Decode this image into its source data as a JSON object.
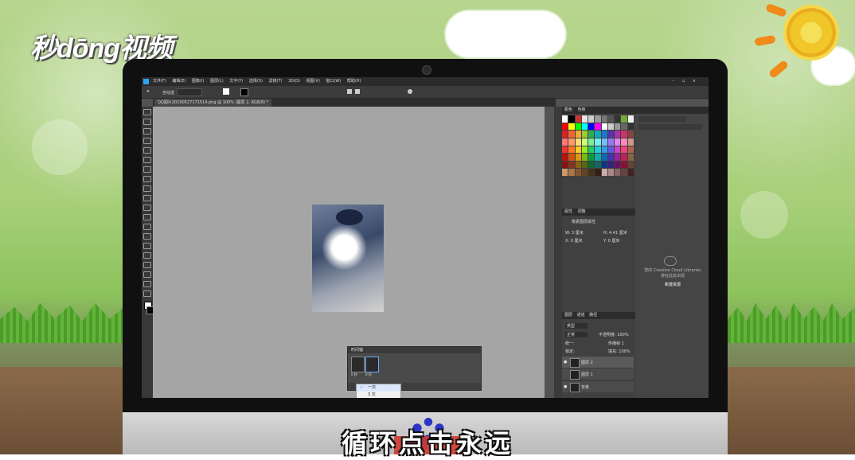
{
  "watermark": {
    "logo_text": "秒dōng视频"
  },
  "photoshop": {
    "menu": [
      "文件(F)",
      "编辑(E)",
      "图像(I)",
      "图层(L)",
      "文字(Y)",
      "选择(S)",
      "滤镜(T)",
      "3D(D)",
      "视图(V)",
      "窗口(W)",
      "帮助(H)"
    ],
    "options_bar": {
      "auto_select_label": "自动选",
      "auto_select_value": "",
      "transform_controls": ""
    },
    "document_tab": "QQ图片20190527171514.png @ 100% (图层 2, RGB/8) *",
    "frame_animation_panel": {
      "title": "时间轴",
      "frames": [
        {
          "label": "0 秒"
        },
        {
          "label": "0 秒"
        }
      ],
      "loop_dropdown": {
        "options": [
          "一次",
          "3 次"
        ],
        "selected": "一次"
      }
    },
    "swatches_panel": {
      "tabs": [
        "颜色",
        "色板"
      ]
    },
    "properties_panel": {
      "tabs": [
        "属性",
        "调整"
      ],
      "title": "像素图层属性",
      "w": "W: 3 厘米",
      "h": "H: 4.41 厘米",
      "x": "X: 0 厘米",
      "y": "Y: 0 厘米"
    },
    "libraries_panel": {
      "text": "您的 Creative Cloud Libraries 将在此处出现",
      "link": "新建资源"
    },
    "layers_panel": {
      "tabs": [
        "图层",
        "通道",
        "路径"
      ],
      "kind_filter": "类型",
      "blend_mode": "正常",
      "opacity": "不透明度: 100%",
      "fill": "填充: 100%",
      "lock_label": "锁定:",
      "unify_label": "统一:",
      "propagate_label": "传播帧 1",
      "layers": [
        {
          "name": "图层 2",
          "visible": true
        },
        {
          "name": "图层 1",
          "visible": false
        },
        {
          "name": "背景",
          "visible": true
        }
      ]
    }
  },
  "subtitle": "循环点击永远",
  "colors": {
    "ps_dark": "#2b2b2b",
    "canvas": "#a5a5a5",
    "accent_blue": "#2a7de1"
  }
}
